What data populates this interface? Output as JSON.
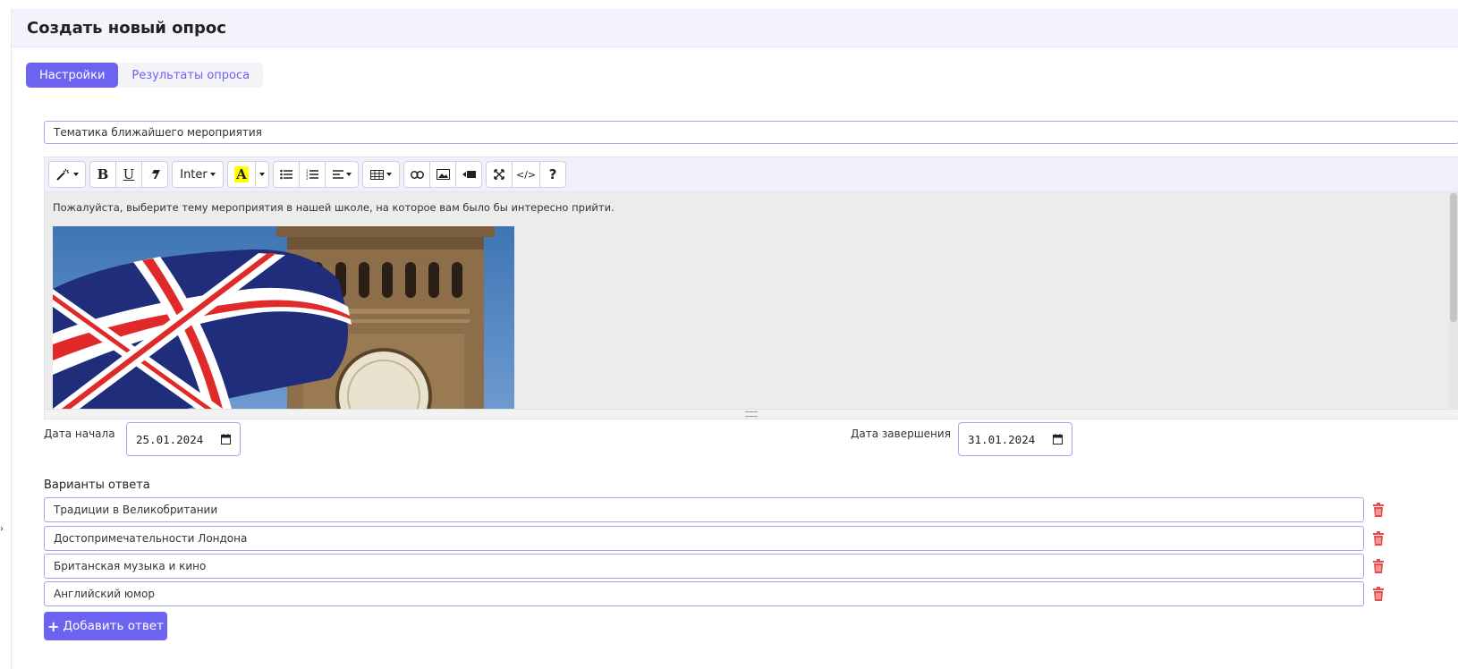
{
  "page": {
    "title": "Создать новый опрос"
  },
  "tabs": [
    {
      "label": "Настройки",
      "active": true
    },
    {
      "label": "Результаты опроса",
      "active": false
    }
  ],
  "survey": {
    "title_value": "Тематика ближайшего мероприятия"
  },
  "toolbar": {
    "font_label": "Inter",
    "bold": "B",
    "underline": "U",
    "help": "?",
    "code": "</>",
    "icons": [
      "magic-wand-icon",
      "bold-icon",
      "underline-icon",
      "eraser-icon",
      "font-family-dropdown",
      "text-color-icon",
      "color-dropdown-caret",
      "unordered-list-icon",
      "ordered-list-icon",
      "align-icon",
      "table-icon",
      "link-icon",
      "picture-icon",
      "video-icon",
      "fullscreen-icon",
      "code-view-icon",
      "help-icon"
    ]
  },
  "editor": {
    "text": "Пожалуйста, выберите тему мероприятия в нашей школе, на которое вам было бы интересно прийти."
  },
  "dates": {
    "start_label": "Дата начала",
    "start_value": "25.01.2024",
    "end_label": "Дата завершения",
    "end_value": "31.01.2024"
  },
  "answers": {
    "title": "Варианты ответа",
    "items": [
      "Традиции в Великобритании",
      "Достопримечательности Лондона",
      "Британская музыка и кино",
      "Английский юмор"
    ],
    "add_label": "Добавить ответ"
  },
  "colors": {
    "accent": "#6c63f0",
    "danger": "#e74c4c",
    "border": "#a9a4f2",
    "header_bg": "#f3f3fb"
  }
}
